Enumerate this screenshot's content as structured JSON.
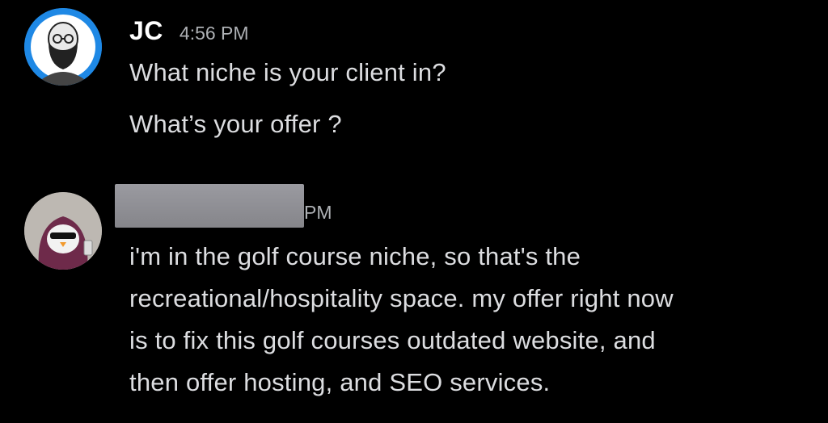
{
  "messages": [
    {
      "author": "JC",
      "time": "4:56 PM",
      "avatar_icon": "bearded-man-avatar",
      "avatar_ring_color": "#1e88e5",
      "lines": [
        "What niche is your client in?",
        "What’s your offer ?"
      ]
    },
    {
      "author": "",
      "time_fragment": "PM",
      "avatar_icon": "penguin-hood-avatar",
      "lines": [
        "i'm in the golf course niche, so that's the",
        "recreational/hospitality space. my offer right now",
        "is to fix this golf courses outdated website, and",
        "then offer hosting, and SEO services."
      ]
    }
  ]
}
